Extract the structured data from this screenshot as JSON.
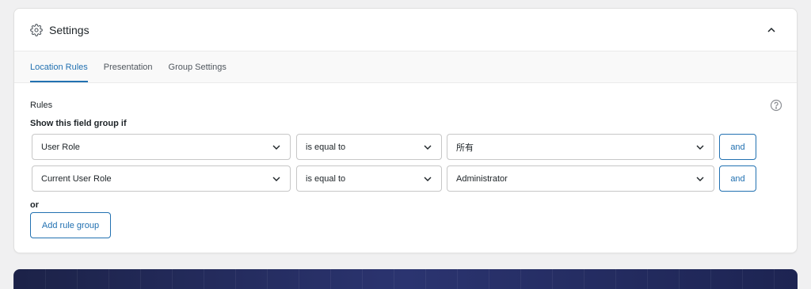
{
  "header": {
    "title": "Settings",
    "icon": "gear-icon",
    "collapse_icon": "chevron-up-icon"
  },
  "tabs": [
    {
      "label": "Location Rules",
      "active": true
    },
    {
      "label": "Presentation",
      "active": false
    },
    {
      "label": "Group Settings",
      "active": false
    }
  ],
  "rules": {
    "label": "Rules",
    "show_label": "Show this field group if",
    "rows": [
      {
        "param": "User Role",
        "operator": "is equal to",
        "value": "所有",
        "and_label": "and"
      },
      {
        "param": "Current User Role",
        "operator": "is equal to",
        "value": "Administrator",
        "and_label": "and"
      }
    ],
    "or_label": "or",
    "add_group_label": "Add rule group"
  },
  "colors": {
    "accent": "#2271b1",
    "background": "#f0f0f1",
    "footer_banner": "#1c2248"
  }
}
